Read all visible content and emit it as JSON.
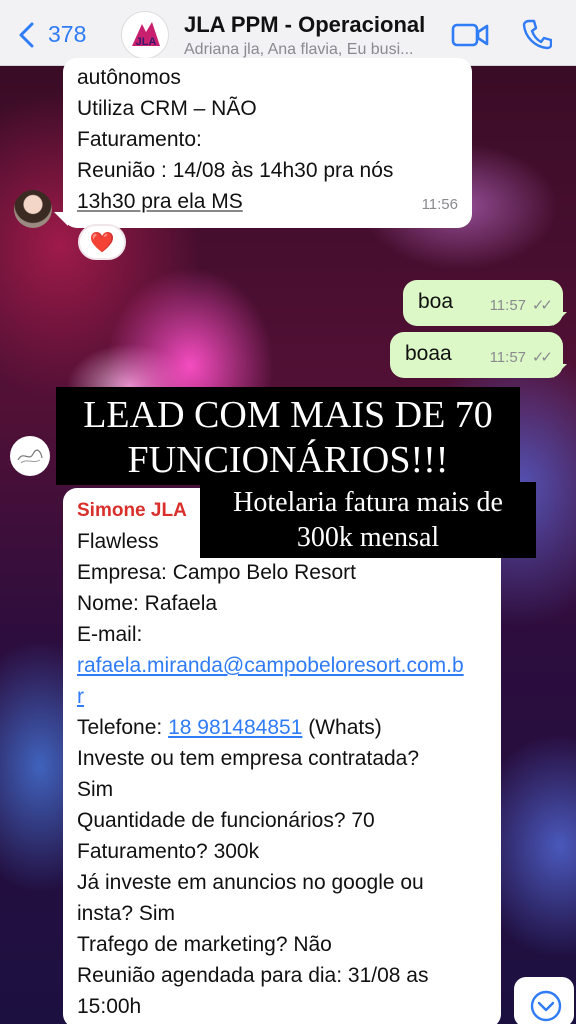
{
  "header": {
    "back_count": "378",
    "title": "JLA PPM - Operacional",
    "subtitle": "Adriana jla, Ana flavia, Eu busi...",
    "avatar_text": "JLA"
  },
  "messages": {
    "m1": {
      "lines": [
        "autônomos",
        "Utiliza CRM –  NÃO",
        "Faturamento:",
        "Reunião : 14/08 às 14h30 pra nós",
        "13h30 pra ela MS"
      ],
      "time": "11:56",
      "reaction": "❤️"
    },
    "m2": {
      "text": "boa",
      "time": "11:57",
      "ticks": "✓✓"
    },
    "m3": {
      "text": "boaa",
      "time": "11:57",
      "ticks": "✓✓"
    },
    "m4": {
      "sender": "Simone JLA",
      "lines": [
        "Flawless",
        "Empresa: Campo Belo Resort",
        "Nome: Rafaela",
        "E-mail:"
      ],
      "email": "rafaela.miranda@campobeloresort.com.br",
      "phone_label": "Telefone:",
      "phone": "18 981484851",
      "phone_suffix": "(Whats)",
      "lines_after": [
        "Investe ou tem empresa contratada?",
        "Sim",
        "Quantidade de funcionários? 70",
        "Faturamento? 300k",
        "Já investe em anuncios no google ou",
        "insta? Sim",
        "Trafego de marketing? Não",
        "Reunião agendada para dia: 31/08 as",
        "15:00h"
      ]
    }
  },
  "overlays": {
    "banner1_line1": "LEAD COM MAIS DE 70",
    "banner1_line2": "FUNCIONÁRIOS!!!",
    "banner2_line1": "Hotelaria fatura mais de",
    "banner2_line2": "300k mensal"
  },
  "icons": {
    "back": "chevron-left-icon",
    "video": "video-camera-icon",
    "phone": "phone-icon",
    "scroll": "chevron-down-circle-icon"
  },
  "colors": {
    "accent": "#2f7cf6",
    "outgoing_bubble": "#dcf8c6",
    "incoming_bubble": "#ffffff",
    "sender_name": "#d9302c",
    "header_bg": "#f2f2f5"
  }
}
